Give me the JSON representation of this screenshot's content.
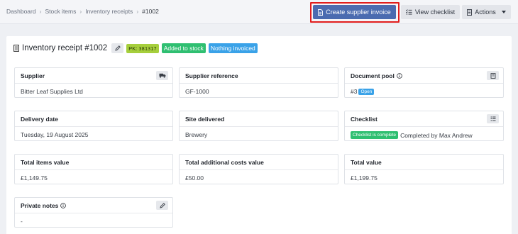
{
  "breadcrumb": {
    "items": [
      "Dashboard",
      "Stock items",
      "Inventory receipts"
    ],
    "current": "#1002",
    "separator": "›"
  },
  "toolbar": {
    "create_invoice_label": "Create supplier invoice",
    "view_checklist_label": "View checklist",
    "actions_label": "Actions",
    "highlight_color": "#e11d1d"
  },
  "header": {
    "title": "Inventory receipt #1002",
    "pk_label": "PK:",
    "pk_code": "381317",
    "status_stock": "Added to stock",
    "status_invoice": "Nothing invoiced"
  },
  "cards": {
    "supplier": {
      "label": "Supplier",
      "value": "Bitter Leaf Supplies Ltd"
    },
    "supplier_reference": {
      "label": "Supplier reference",
      "value": "GF-1000"
    },
    "document_pool": {
      "label": "Document pool",
      "value": "#3",
      "status": "Open"
    },
    "delivery_date": {
      "label": "Delivery date",
      "value": "Tuesday, 19 August 2025"
    },
    "site_delivered": {
      "label": "Site delivered",
      "value": "Brewery"
    },
    "checklist": {
      "label": "Checklist",
      "status": "Checklist is complete",
      "completed_by": "Completed by Max Andrew"
    },
    "total_items_value": {
      "label": "Total items value",
      "value": "£1,149.75"
    },
    "total_additional_costs": {
      "label": "Total additional costs value",
      "value": "£50.00"
    },
    "total_value": {
      "label": "Total value",
      "value": "£1,199.75"
    },
    "private_notes": {
      "label": "Private notes",
      "value": "-"
    }
  }
}
